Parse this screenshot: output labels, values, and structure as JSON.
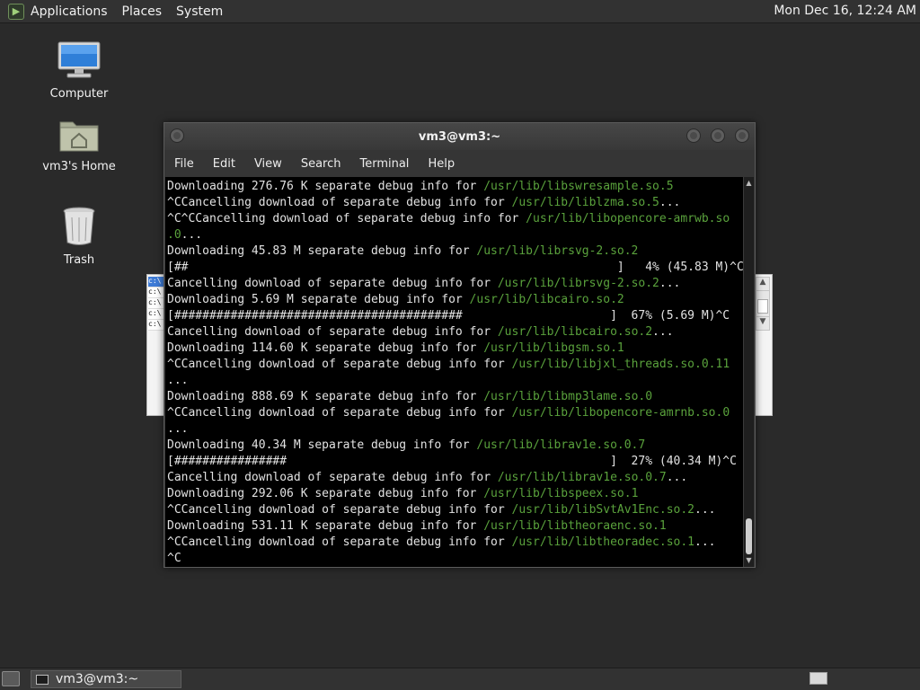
{
  "top_panel": {
    "menus": [
      "Applications",
      "Places",
      "System"
    ],
    "clock": "Mon Dec 16, 12:24 AM"
  },
  "desktop_icons": [
    {
      "label": "Computer",
      "icon": "computer-icon"
    },
    {
      "label": "vm3's Home",
      "icon": "home-folder-icon"
    },
    {
      "label": "Trash",
      "icon": "trash-icon"
    }
  ],
  "background_window": {
    "cells": [
      "c:\\",
      "c:\\",
      "c:\\",
      "c:\\",
      "c:\\"
    ]
  },
  "terminal": {
    "title": "vm3@vm3:~",
    "menu": [
      "File",
      "Edit",
      "View",
      "Search",
      "Terminal",
      "Help"
    ],
    "lines": [
      {
        "text": "Downloading 276.76 K separate debug info for ",
        "path": "/usr/lib/libswresample.so.5"
      },
      {
        "text": "^CCancelling download of separate debug info for ",
        "path": "/usr/lib/liblzma.so.5",
        "suffix": "..."
      },
      {
        "text": "^C^CCancelling download of separate debug info for ",
        "path": "/usr/lib/libopencore-amrwb.so"
      },
      {
        "text": "",
        "path": ".0",
        "suffix": "..."
      },
      {
        "text": "Downloading 45.83 M separate debug info for ",
        "path": "/usr/lib/librsvg-2.so.2"
      },
      {
        "text": "[##                                                             ]   4% (45.83 M)^C"
      },
      {
        "text": "Cancelling download of separate debug info for ",
        "path": "/usr/lib/librsvg-2.so.2",
        "suffix": "..."
      },
      {
        "text": "Downloading 5.69 M separate debug info for ",
        "path": "/usr/lib/libcairo.so.2"
      },
      {
        "text": "[#########################################                     ]  67% (5.69 M)^C"
      },
      {
        "text": "Cancelling download of separate debug info for ",
        "path": "/usr/lib/libcairo.so.2",
        "suffix": "..."
      },
      {
        "text": "Downloading 114.60 K separate debug info for ",
        "path": "/usr/lib/libgsm.so.1"
      },
      {
        "text": "^CCancelling download of separate debug info for ",
        "path": "/usr/lib/libjxl_threads.so.0.11"
      },
      {
        "text": "..."
      },
      {
        "text": "Downloading 888.69 K separate debug info for ",
        "path": "/usr/lib/libmp3lame.so.0"
      },
      {
        "text": "^CCancelling download of separate debug info for ",
        "path": "/usr/lib/libopencore-amrnb.so.0"
      },
      {
        "text": "..."
      },
      {
        "text": "Downloading 40.34 M separate debug info for ",
        "path": "/usr/lib/librav1e.so.0.7"
      },
      {
        "text": "[################                                              ]  27% (40.34 M)^C"
      },
      {
        "text": "Cancelling download of separate debug info for ",
        "path": "/usr/lib/librav1e.so.0.7",
        "suffix": "..."
      },
      {
        "text": "Downloading 292.06 K separate debug info for ",
        "path": "/usr/lib/libspeex.so.1"
      },
      {
        "text": "^CCancelling download of separate debug info for ",
        "path": "/usr/lib/libSvtAv1Enc.so.2",
        "suffix": "..."
      },
      {
        "text": "Downloading 531.11 K separate debug info for ",
        "path": "/usr/lib/libtheoraenc.so.1"
      },
      {
        "text": "^CCancelling download of separate debug info for ",
        "path": "/usr/lib/libtheoradec.so.1",
        "suffix": "..."
      },
      {
        "text": "^C"
      }
    ]
  },
  "taskbar": {
    "task_label": "vm3@vm3:~"
  },
  "colors": {
    "path_text": "#5aa23c",
    "terminal_bg": "#000000",
    "desktop_bg": "#2a2a2a"
  }
}
